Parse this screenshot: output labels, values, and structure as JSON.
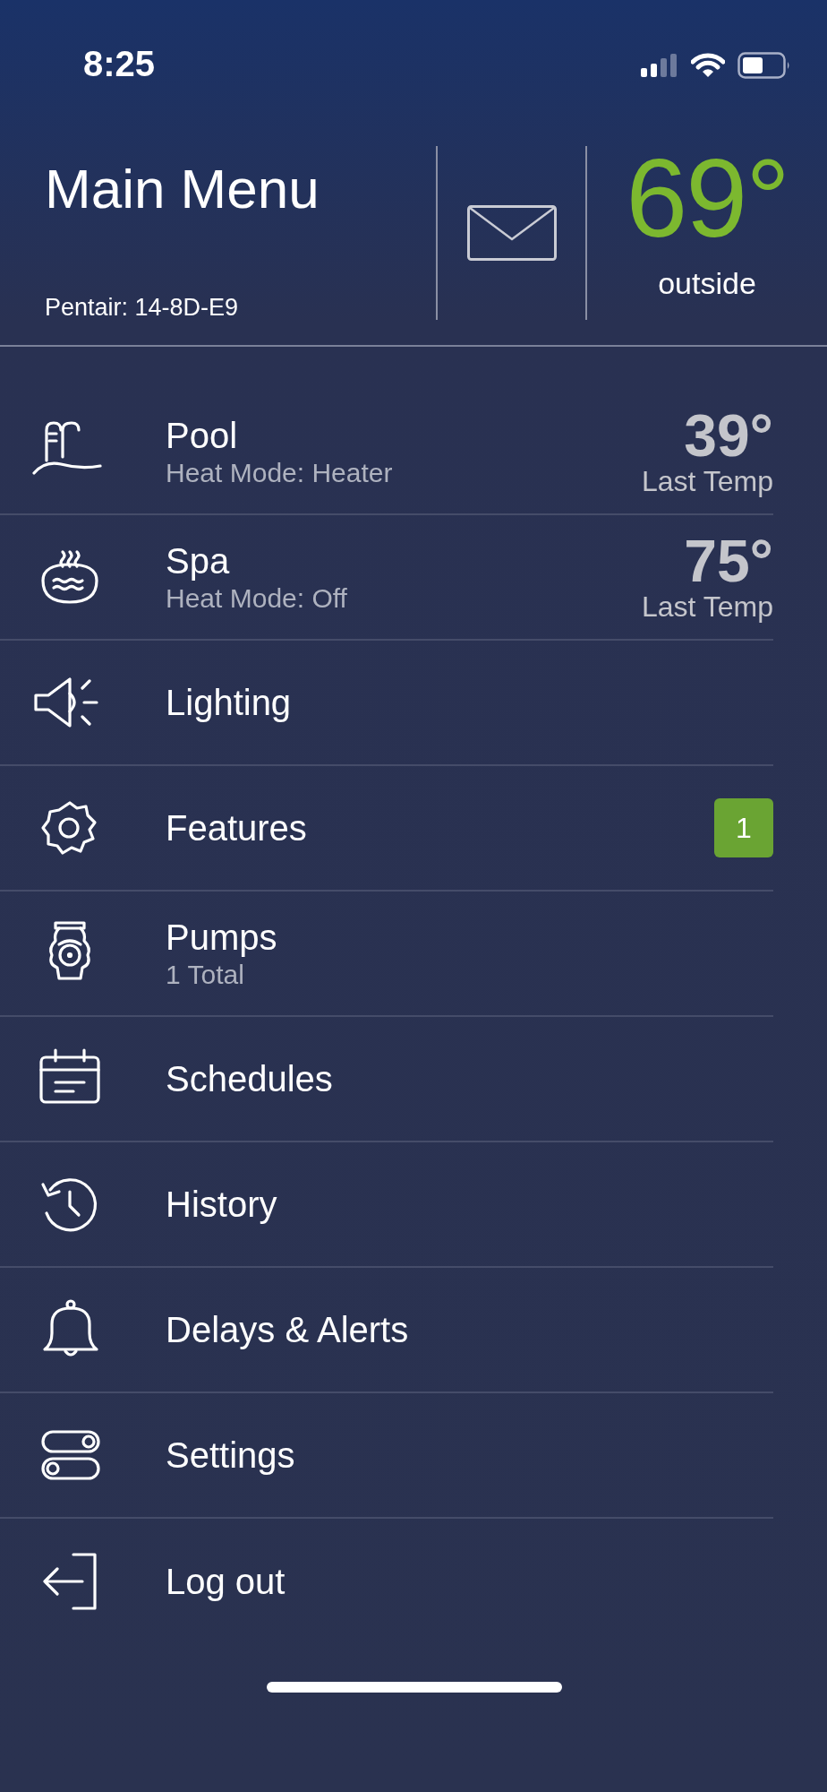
{
  "status_bar": {
    "time": "8:25"
  },
  "header": {
    "title": "Main Menu",
    "subtitle": "Pentair: 14-8D-E9",
    "temperature": "69°",
    "temperature_label": "outside"
  },
  "menu": [
    {
      "kind": "pool",
      "label": "Pool",
      "detail": "Heat Mode: Heater",
      "temp": "39°",
      "temp_label": "Last Temp"
    },
    {
      "kind": "spa",
      "label": "Spa",
      "detail": "Heat Mode: Off",
      "temp": "75°",
      "temp_label": "Last Temp"
    },
    {
      "kind": "lighting",
      "label": "Lighting"
    },
    {
      "kind": "features",
      "label": "Features",
      "badge": "1"
    },
    {
      "kind": "pumps",
      "label": "Pumps",
      "detail": "1 Total"
    },
    {
      "kind": "schedules",
      "label": "Schedules"
    },
    {
      "kind": "history",
      "label": "History"
    },
    {
      "kind": "alerts",
      "label": "Delays & Alerts"
    },
    {
      "kind": "settings",
      "label": "Settings"
    },
    {
      "kind": "logout",
      "label": "Log out"
    }
  ]
}
